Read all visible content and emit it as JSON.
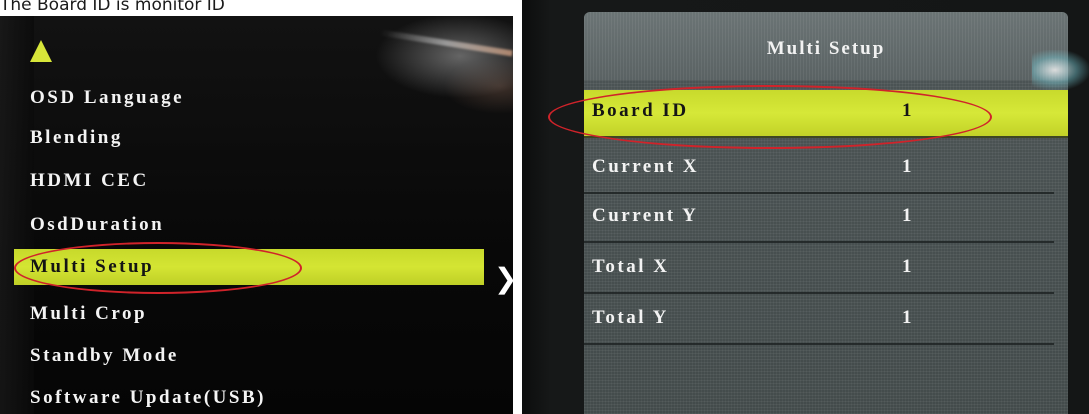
{
  "caption": "The Board ID is monitor ID",
  "left_menu": {
    "items": [
      {
        "label": "OSD Language",
        "selected": false
      },
      {
        "label": "Blending",
        "selected": false
      },
      {
        "label": "HDMI CEC",
        "selected": false
      },
      {
        "label": "OsdDuration",
        "selected": false
      },
      {
        "label": "Multi Setup",
        "selected": true
      },
      {
        "label": "Multi Crop",
        "selected": false
      },
      {
        "label": "Standby Mode",
        "selected": false
      },
      {
        "label": "Software Update(USB)",
        "selected": false
      }
    ],
    "up_arrow_icon": "triangle-up-icon",
    "submenu_arrow_icon": "chevron-right-icon",
    "submenu_arrow_glyph": "❯"
  },
  "multi_setup": {
    "title": "Multi Setup",
    "rows": [
      {
        "label": "Board ID",
        "value": "1",
        "selected": true
      },
      {
        "label": "Current X",
        "value": "1",
        "selected": false
      },
      {
        "label": "Current Y",
        "value": "1",
        "selected": false
      },
      {
        "label": "Total X",
        "value": "1",
        "selected": false
      },
      {
        "label": "Total Y",
        "value": "1",
        "selected": false
      }
    ]
  },
  "colors": {
    "highlight": "#d4e533",
    "annotation_ring": "#d0232a",
    "panel_bg": "#4b5353",
    "menu_text": "#f4f4f4"
  }
}
